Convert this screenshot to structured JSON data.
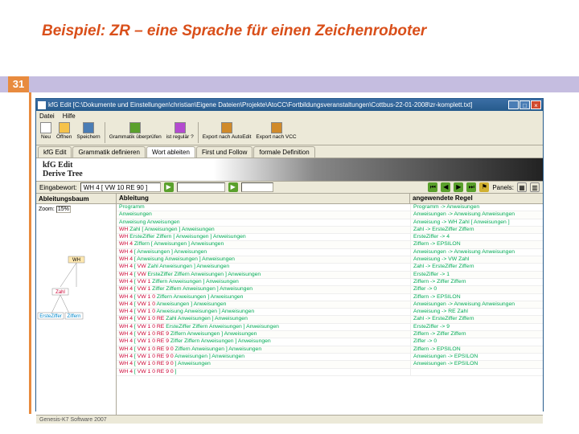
{
  "slide": {
    "title": "Beispiel:  ZR – eine Sprache für einen Zeichenroboter",
    "number": "31"
  },
  "window": {
    "title": "kfG Edit [C:\\Dokumente und Einstellungen\\christian\\Eigene Dateien\\Projekte\\AtoCC\\Fortbildungsveranstaltungen\\Cottbus-22-01-2008\\zr-komplett.txt]",
    "menu": [
      "Datei",
      "Hilfe"
    ],
    "toolbar": [
      {
        "icon": "#fff",
        "label": "Neu"
      },
      {
        "icon": "#f5c24a",
        "label": "Öffnen"
      },
      {
        "icon": "#4a7db5",
        "label": "Speichern"
      },
      {
        "sep": true
      },
      {
        "icon": "#5aa02c",
        "label": "Grammatik überprüfen"
      },
      {
        "icon": "#b44ad0",
        "label": "ist regulär ?"
      },
      {
        "sep": true
      },
      {
        "icon": "#d08a2a",
        "label": "Export nach AutoEdit"
      },
      {
        "icon": "#d08a2a",
        "label": "Export nach VCC"
      }
    ],
    "tabs": [
      "kfG Edit",
      "Grammatik definieren",
      "Wort ableiten",
      "First und Follow",
      "formale Definition"
    ],
    "active_tab": 2,
    "header": {
      "l1": "kfG Edit",
      "l2": "Derive Tree"
    },
    "input_row": {
      "label": "Eingabewort:",
      "value": "WH 4 [ VW 10 RE 90 ]",
      "panels_label": "Panels:"
    },
    "grid_headers": {
      "left": "Ableitungsbaum",
      "zoom_label": "Zoom:",
      "zoom_value": "15%",
      "mid": "Ableitung",
      "right": "angewendete Regel"
    },
    "rows": [
      {
        "l": "Programm",
        "r": "Programm -> Anweisungen"
      },
      {
        "l": "Anweisungen",
        "r": "Anweisungen -> Anweisung Anweisungen"
      },
      {
        "l": "Anweisung Anweisungen",
        "r": "Anweisung -> WH Zahl [ Anweisungen ]"
      },
      {
        "l": "WH Zahl [ Anweisungen ] Anweisungen",
        "r": "Zahl -> ErsteZiffer Ziffern"
      },
      {
        "l": "WH ErsteZiffer Ziffern [ Anweisungen ] Anweisungen",
        "r": "ErsteZiffer -> 4"
      },
      {
        "l": "WH 4 Ziffern [ Anweisungen ] Anweisungen",
        "r": "Ziffern -> EPSILON"
      },
      {
        "l": "WH 4 [ Anweisungen ] Anweisungen",
        "r": "Anweisungen -> Anweisung Anweisungen"
      },
      {
        "l": "WH 4 [ Anweisung Anweisungen ] Anweisungen",
        "r": "Anweisung -> VW Zahl"
      },
      {
        "l": "WH 4 [ VW Zahl Anweisungen ] Anweisungen",
        "r": "Zahl -> ErsteZiffer Ziffern"
      },
      {
        "l": "WH 4 [ VW ErsteZiffer Ziffern Anweisungen ] Anweisungen",
        "r": "ErsteZiffer -> 1"
      },
      {
        "l": "WH 4 [ VW 1 Ziffern Anweisungen ] Anweisungen",
        "r": "Ziffern -> Ziffer Ziffern"
      },
      {
        "l": "WH 4 [ VW 1 Ziffer Ziffern Anweisungen ] Anweisungen",
        "r": "Ziffer -> 0"
      },
      {
        "l": "WH 4 [ VW 1 0 Ziffern Anweisungen ] Anweisungen",
        "r": "Ziffern -> EPSILON"
      },
      {
        "l": "WH 4 [ VW 1 0 Anweisungen ] Anweisungen",
        "r": "Anweisungen -> Anweisung Anweisungen"
      },
      {
        "l": "WH 4 [ VW 1 0 Anweisung Anweisungen ] Anweisungen",
        "r": "Anweisung -> RE Zahl"
      },
      {
        "l": "WH 4 [ VW 1 0 RE Zahl Anweisungen ] Anweisungen",
        "r": "Zahl -> ErsteZiffer Ziffern"
      },
      {
        "l": "WH 4 [ VW 1 0 RE ErsteZiffer Ziffern Anweisungen ] Anweisungen",
        "r": "ErsteZiffer -> 9"
      },
      {
        "l": "WH 4 [ VW 1 0 RE 9 Ziffern Anweisungen ] Anweisungen",
        "r": "Ziffern -> Ziffer Ziffern"
      },
      {
        "l": "WH 4 [ VW 1 0 RE 9 Ziffer Ziffern Anweisungen ] Anweisungen",
        "r": "Ziffer -> 0"
      },
      {
        "l": "WH 4 [ VW 1 0 RE 9 0 Ziffern Anweisungen ] Anweisungen",
        "r": "Ziffern -> EPSILON"
      },
      {
        "l": "WH 4 [ VW 1 0 RE 9 0 Anweisungen ] Anweisungen",
        "r": "Anweisungen -> EPSILON"
      },
      {
        "l": "WH 4 [ VW 1 0 RE 9 0 ] Anweisungen",
        "r": "Anweisungen -> EPSILON"
      },
      {
        "l": "WH 4 [ VW 1 0 RE 9 0 ]",
        "r": ""
      }
    ],
    "status": "Genesis-K7 Software 2007"
  }
}
